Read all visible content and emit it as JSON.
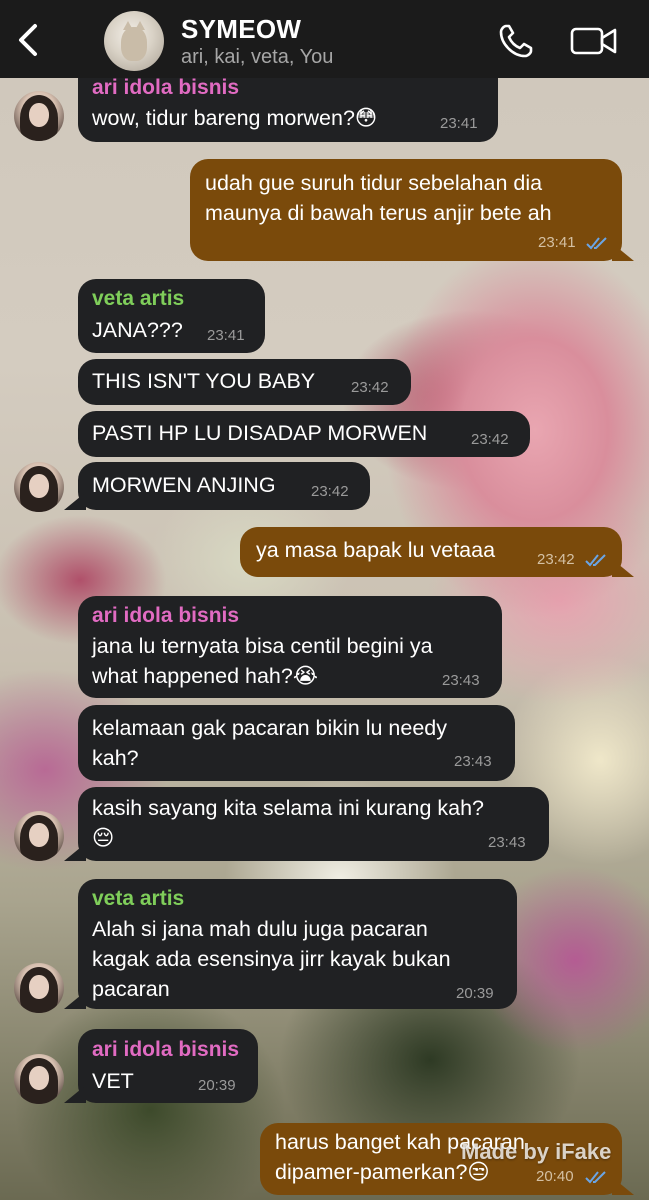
{
  "header": {
    "title": "SYMEOW",
    "members": "ari, kai, veta, You",
    "back_icon": "chevron-left-icon",
    "call_icon": "phone-icon",
    "video_icon": "video-camera-icon"
  },
  "messages": [
    {
      "dir": "in",
      "sender": "ari idola bisnis",
      "sender_color": "#e16bc2",
      "text": "wow, tidur bareng morwen?😳",
      "time": "23:41"
    },
    {
      "dir": "out",
      "text": "udah gue suruh tidur sebelahan dia\nmaunya di bawah terus anjir bete ah",
      "time": "23:41",
      "status": "read"
    },
    {
      "dir": "in",
      "sender": "veta artis",
      "sender_color": "#7fce5a",
      "text": "JANA???",
      "time": "23:41"
    },
    {
      "dir": "in",
      "text": "THIS ISN'T YOU BABY",
      "time": "23:42"
    },
    {
      "dir": "in",
      "text": "PASTI HP LU DISADAP MORWEN",
      "time": "23:42"
    },
    {
      "dir": "in",
      "text": "MORWEN ANJING",
      "time": "23:42"
    },
    {
      "dir": "out",
      "text": "ya masa bapak lu vetaaa",
      "time": "23:42",
      "status": "read"
    },
    {
      "dir": "in",
      "sender": "ari idola bisnis",
      "sender_color": "#e16bc2",
      "text": "jana lu ternyata bisa centil begini ya\nwhat happened hah?😭",
      "time": "23:43"
    },
    {
      "dir": "in",
      "text": "kelamaan gak pacaran bikin lu needy\nkah?",
      "time": "23:43"
    },
    {
      "dir": "in",
      "text": "kasih sayang kita selama ini kurang kah?\n😔",
      "time": "23:43"
    },
    {
      "dir": "in",
      "sender": "veta artis",
      "sender_color": "#7fce5a",
      "text": "Alah si jana mah dulu juga pacaran\nkagak ada esensinya jirr kayak bukan\npacaran",
      "time": "20:39"
    },
    {
      "dir": "in",
      "sender": "ari idola bisnis",
      "sender_color": "#e16bc2",
      "text": "VET",
      "time": "20:39"
    },
    {
      "dir": "out",
      "text": "harus banget kah pacaran\ndipamer-pamerkan?😒",
      "time": "20:40",
      "status": "read"
    }
  ],
  "watermark": "Made by iFake",
  "colors": {
    "header_bg": "#1b1b1b",
    "incoming_bubble": "#202123",
    "outgoing_bubble": "#7a4a0b",
    "read_ticks": "#6aa5e6"
  }
}
